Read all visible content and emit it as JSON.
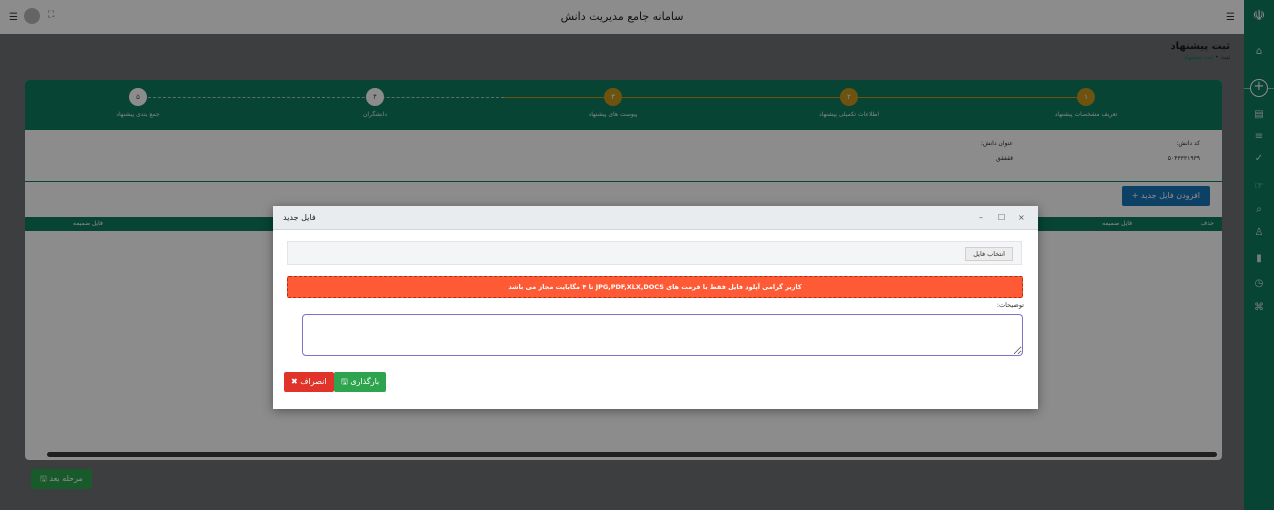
{
  "header": {
    "app_title": "سامانه جامع مدیریت دانش",
    "menu_icon": "hamburger-icon",
    "expand_icon": "expand-icon"
  },
  "page": {
    "title": "ثبت پیشنهاد",
    "breadcrumb": [
      "ثبت",
      "ثبت پیشنهاد"
    ],
    "breadcrumb_sep": "•"
  },
  "stepper": {
    "steps": [
      {
        "number": "۱",
        "label": "تعریف مشخصات پیشنهاد",
        "status": "done"
      },
      {
        "number": "۲",
        "label": "اطلاعات تکمیلی پیشنهاد",
        "status": "done"
      },
      {
        "number": "۳",
        "label": "پیوست های پیشنهاد",
        "status": "done"
      },
      {
        "number": "۴",
        "label": "دانشگران",
        "status": "todo"
      },
      {
        "number": "۵",
        "label": "جمع بندی پیشنهاد",
        "status": "todo"
      }
    ]
  },
  "info": {
    "code_label": "کد دانش:",
    "code_value": "۵۰۴۳۳۳۱۹۳۹",
    "subject_label": "عنوان دانش:",
    "subject_value": "ققفقق"
  },
  "grid": {
    "add_button": "افزودن فایل جدید +",
    "columns": [
      "حذف",
      "فایل ضمیمه",
      "فایل ضمیمه"
    ]
  },
  "footer": {
    "next_button": "مرحله بعد"
  },
  "modal": {
    "title": "فایل جدید",
    "choose_file": "انتخاب فایل",
    "alert": "کاربر گرامی آپلود فایل فقط با فرمت های JPG,PDF,XLX,DOCS تا ۴ مگابایت مجاز می باشد",
    "description_label": "توضیحات:",
    "upload_button": "بارگذاری",
    "cancel_button": "انصراف",
    "controls": {
      "minimize": "–",
      "maximize": "☐",
      "close": "×"
    }
  },
  "colors": {
    "brand": "#0e7c5e",
    "step_done": "#c8951c",
    "alert": "#ff5a36",
    "upload": "#2ea44f",
    "cancel": "#e0342b",
    "add": "#1976b8"
  }
}
